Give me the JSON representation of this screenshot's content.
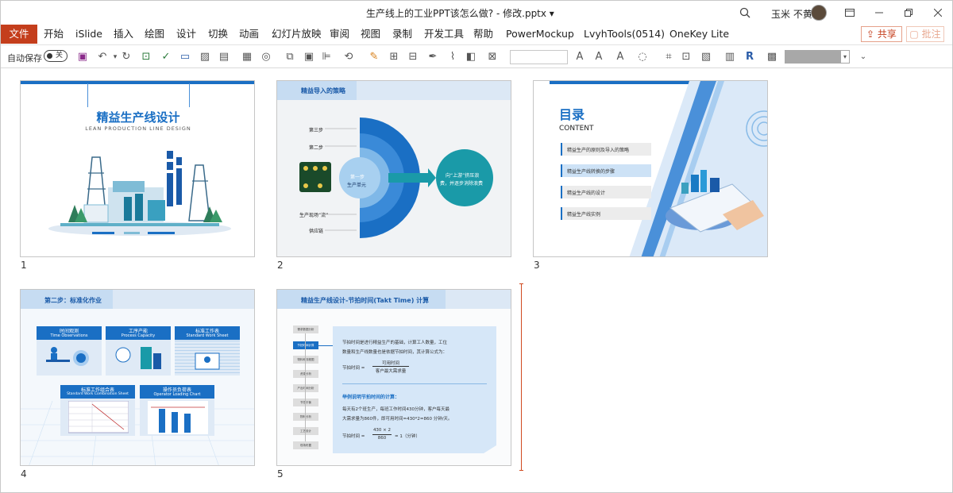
{
  "window": {
    "title": "生产线上的工业PPT该怎么做? - 修改.pptx ▾",
    "user": "玉米 不黄"
  },
  "ribbon": {
    "tabs": [
      "文件",
      "开始",
      "iSlide",
      "插入",
      "绘图",
      "设计",
      "切换",
      "动画",
      "幻灯片放映",
      "审阅",
      "视图",
      "录制",
      "开发工具",
      "帮助",
      "PowerMockup",
      "LvyhTools(0514)",
      "OneKey Lite"
    ],
    "share_label": "共享",
    "comment_label": "批注"
  },
  "toolbar": {
    "autosave_label": "自动保存",
    "autosave_state": "关"
  },
  "slides": [
    {
      "number": "1",
      "title": "精益生产线设计",
      "subtitle": "LEAN PRODUCTION LINE DESIGN"
    },
    {
      "number": "2",
      "header": "精益导入的策略",
      "labels": [
        "第三步",
        "第二步",
        "生产现场“流”",
        "供应链"
      ],
      "center": [
        "第一步",
        "生产单元"
      ],
      "circle_text": [
        "向“上游”挤压浪",
        "费，并逐步消除浪费"
      ]
    },
    {
      "number": "3",
      "title": "目录",
      "subtitle": "CONTENT",
      "items": [
        "精益生产的原则及导入的策略",
        "精益生产线转换的步骤",
        "精益生产线的设计",
        "精益生产线实例"
      ]
    },
    {
      "number": "4",
      "header": "第二步：标准化作业",
      "cards": [
        {
          "cn": "时间观测",
          "en": "Time Observations"
        },
        {
          "cn": "工序产能",
          "en": "Process Capacity"
        },
        {
          "cn": "标准工作表",
          "en": "Standard Work Sheet"
        },
        {
          "cn": "标准工作组合表",
          "en": "Standard Work Combination Sheet"
        },
        {
          "cn": "操作员负荷表",
          "en": "Operator Loading Chart"
        }
      ]
    },
    {
      "number": "5",
      "header": "精益生产线设计-节拍时间(Takt Time) 计算",
      "side_items": [
        "需求数据分析",
        "节拍时间计算",
        "物料和流程图",
        "资源分析",
        "产出时间分析",
        "节拍平衡",
        "物料分析",
        "工艺设计",
        "现场布置"
      ],
      "para": [
        "节拍时间是进行精益生产的基础，计算工人数量，工位",
        "数量和生产线数量也是依据节拍时间，其计算公式为："
      ],
      "formula_label": "节拍时间 =",
      "formula_num": "可用时间",
      "formula_den": "客户最大需求量",
      "example_title": "举例说明节拍时间的计算：",
      "example": [
        "每天有2个班生产，每班工作时间430分钟，客户每天最",
        "大需求量为860件，即可用时间=430*2=860 分钟/天。"
      ],
      "calc_label": "节拍时间 =",
      "calc_num": "430 × 2",
      "calc_den": "860",
      "calc_result": "= 1（分钟）"
    }
  ]
}
